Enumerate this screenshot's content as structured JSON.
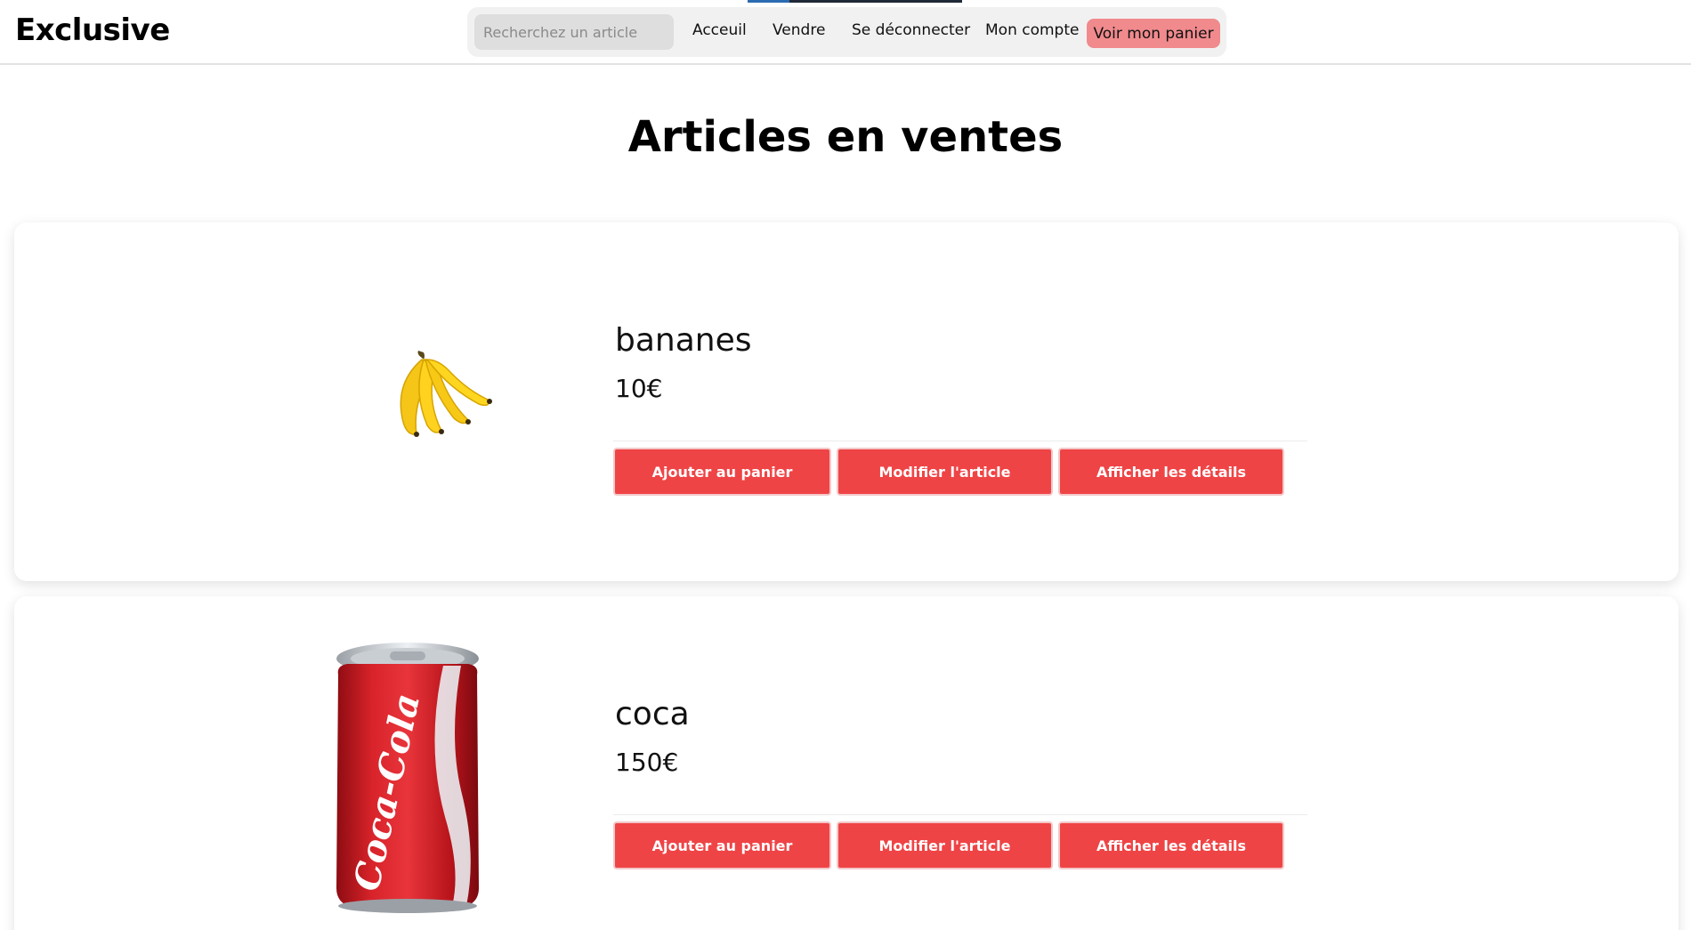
{
  "header": {
    "logo": "Exclusive",
    "search_placeholder": "Recherchez un article",
    "nav": {
      "accueil": "Acceuil",
      "vendre": "Vendre",
      "logout": "Se déconnecter",
      "compte": "Mon compte",
      "panier": "Voir mon panier"
    },
    "panier_color": "#f08a8d"
  },
  "main": {
    "title": "Articles en ventes",
    "products": [
      {
        "name": "bananes",
        "price": "10€",
        "image_icon": "bananas-image",
        "buttons": {
          "add": "Ajouter au panier",
          "edit": "Modifier l'article",
          "details": "Afficher les détails"
        }
      },
      {
        "name": "coca",
        "price": "150€",
        "image_icon": "coca-cola-can-image",
        "image_text": "Coca-Cola",
        "buttons": {
          "add": "Ajouter au panier",
          "edit": "Modifier l'article",
          "details": "Afficher les détails"
        }
      }
    ],
    "button_color": "#ef4446"
  }
}
